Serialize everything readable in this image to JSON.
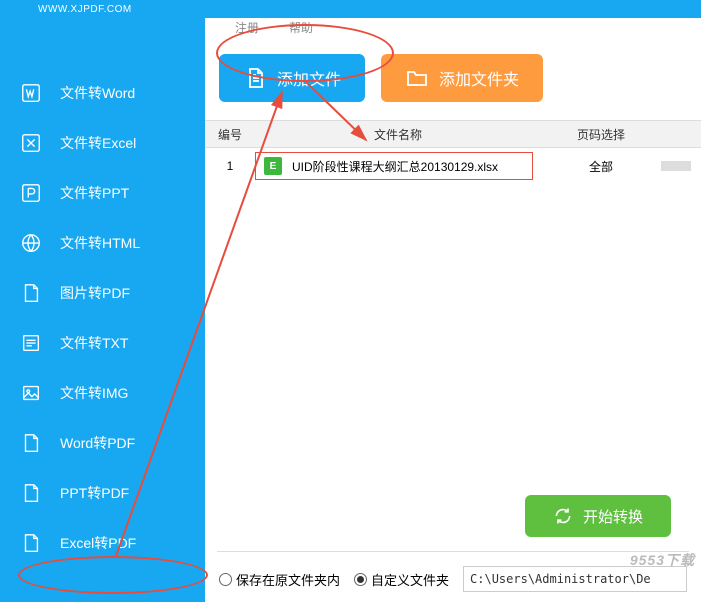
{
  "app": {
    "site": "WWW.XJPDF.COM"
  },
  "topLinks": {
    "register": "注册",
    "help": "帮助"
  },
  "sidebar": {
    "items": [
      {
        "label": "文件转Word",
        "icon": "word"
      },
      {
        "label": "文件转Excel",
        "icon": "excel"
      },
      {
        "label": "文件转PPT",
        "icon": "ppt"
      },
      {
        "label": "文件转HTML",
        "icon": "html"
      },
      {
        "label": "图片转PDF",
        "icon": "pdf"
      },
      {
        "label": "文件转TXT",
        "icon": "txt"
      },
      {
        "label": "文件转IMG",
        "icon": "img"
      },
      {
        "label": "Word转PDF",
        "icon": "pdf"
      },
      {
        "label": "PPT转PDF",
        "icon": "pdf"
      },
      {
        "label": "Excel转PDF",
        "icon": "pdf"
      }
    ]
  },
  "toolbar": {
    "addFile": "添加文件",
    "addFolder": "添加文件夹"
  },
  "table": {
    "headers": {
      "num": "编号",
      "name": "文件名称",
      "page": "页码选择"
    },
    "rows": [
      {
        "num": "1",
        "name": "UID阶段性课程大纲汇总20130129.xlsx",
        "iconLetter": "E",
        "page": "全部"
      }
    ]
  },
  "convert": {
    "start": "开始转换"
  },
  "save": {
    "inPlace": "保存在原文件夹内",
    "custom": "自定义文件夹",
    "path": "C:\\Users\\Administrator\\De"
  },
  "watermark": "9553下载"
}
